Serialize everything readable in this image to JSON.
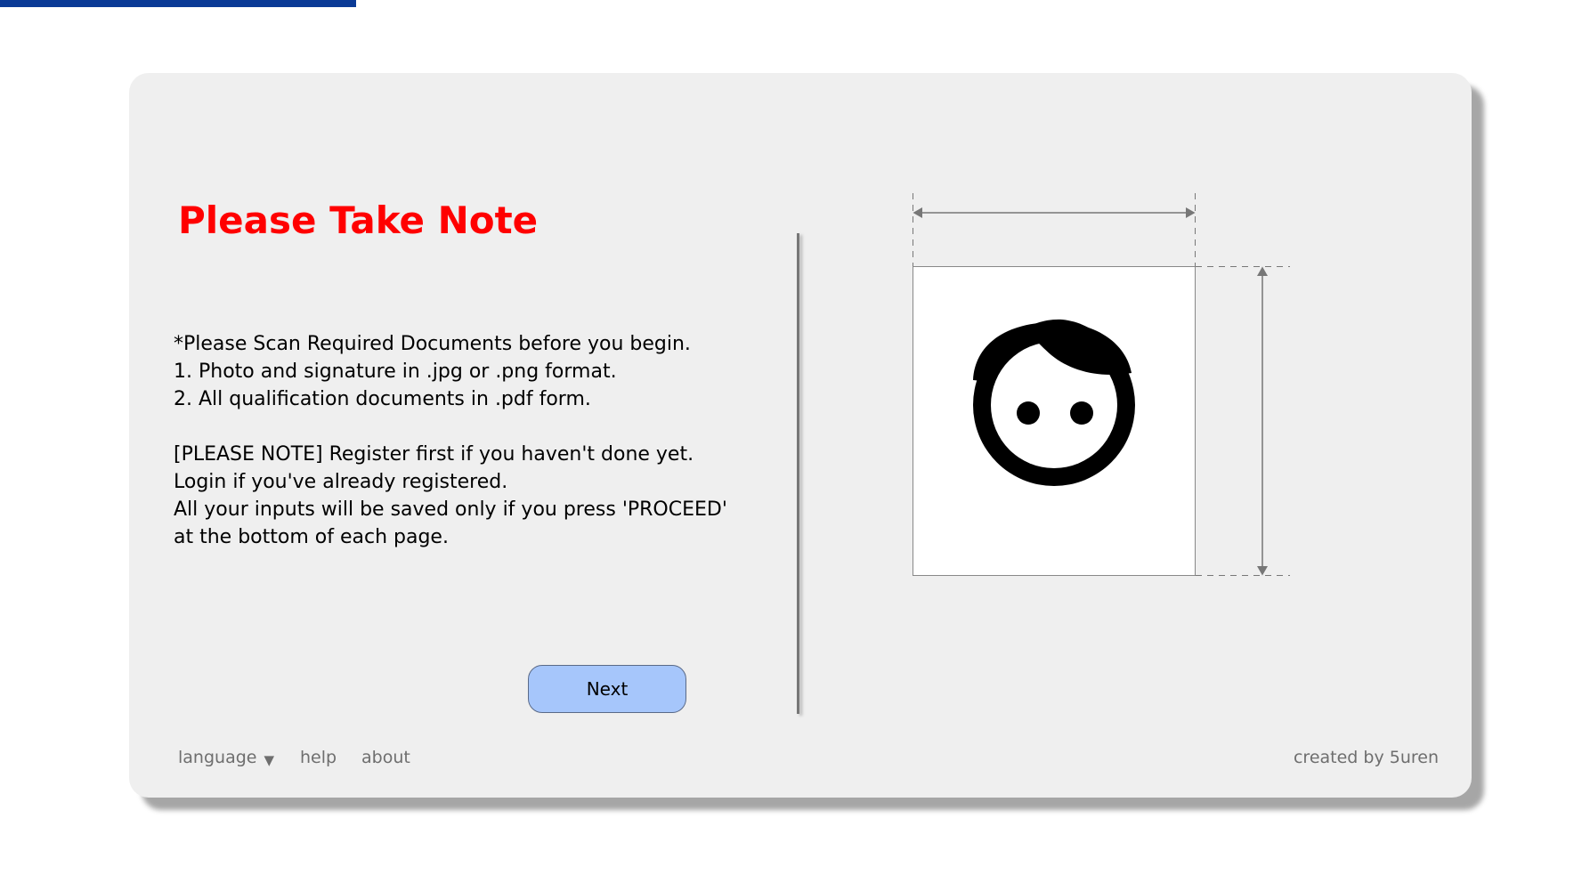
{
  "notice": {
    "title": "Please Take Note",
    "lines": [
      "*Please Scan Required Documents before you begin.",
      "1. Photo and signature in .jpg or .png format.",
      "2. All qualification documents in .pdf form.",
      "[PLEASE NOTE] Register first if you haven't done yet.",
      "Login if you've already registered.",
      "All your inputs will be saved only if you press 'PROCEED'",
      "at the bottom of each page."
    ]
  },
  "actions": {
    "next_label": "Next"
  },
  "photo_guide": {
    "icon": "face-icon"
  },
  "footer": {
    "language_label": "language",
    "language_icon": "caret-down-icon",
    "help_label": "help",
    "about_label": "about",
    "credit": "created by 5uren"
  },
  "colors": {
    "top_accent": "#0a3a96",
    "title": "#ff0000",
    "button": "#a6c6fb",
    "card_background": "#efefef"
  }
}
